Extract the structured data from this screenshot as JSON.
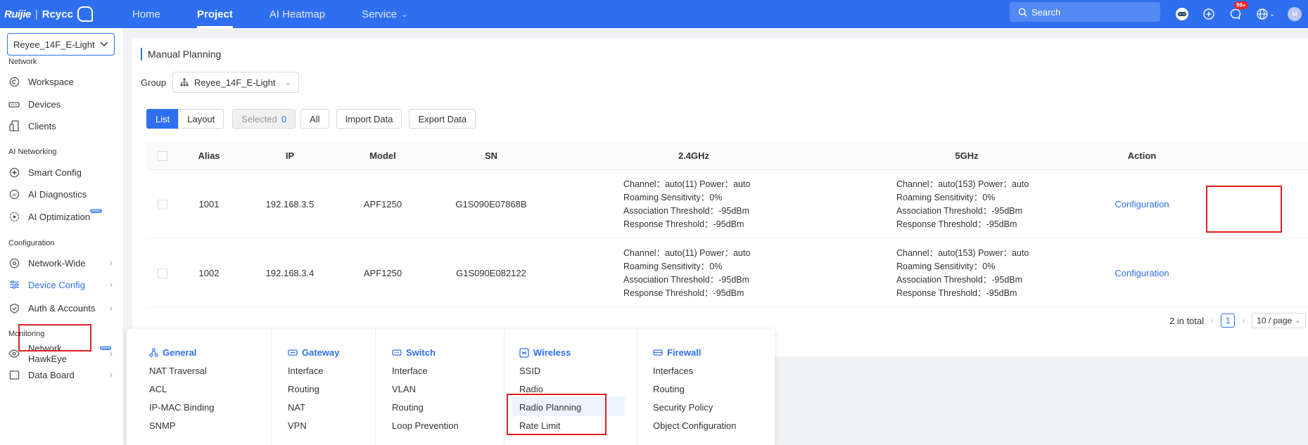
{
  "header": {
    "brand": "Ruijie",
    "brand_sub": "Rcycc",
    "nav": [
      {
        "label": "Home"
      },
      {
        "label": "Project"
      },
      {
        "label": "AI Heatmap"
      },
      {
        "label": "Service"
      }
    ],
    "search_placeholder": "Search",
    "notification_badge": "99+",
    "avatar_text": "M"
  },
  "sidebar": {
    "group_value": "Reyee_14F_E-Light",
    "sections": {
      "network": "Network",
      "ai": "AI Networking",
      "config": "Configuration",
      "monitoring": "Monitoring"
    },
    "items": {
      "workspace": "Workspace",
      "devices": "Devices",
      "clients": "Clients",
      "smart_config": "Smart Config",
      "ai_diagnostics": "AI Diagnostics",
      "ai_optimization": "AI Optimization",
      "network_wide": "Network-Wide",
      "device_config": "Device Config",
      "auth_accounts": "Auth & Accounts",
      "hawkeye": "Network HawkEye",
      "data_board": "Data Board"
    },
    "beta_label": "Beta"
  },
  "main": {
    "title": "Manual Planning",
    "group_label": "Group",
    "group_value": "Reyee_14F_E-Light",
    "toolbar": {
      "list": "List",
      "layout": "Layout",
      "selected": "Selected",
      "selected_count": "0",
      "all": "All",
      "import": "Import Data",
      "export": "Export Data"
    },
    "columns": [
      "Alias",
      "IP",
      "Model",
      "SN",
      "2.4GHz",
      "5GHz",
      "Action"
    ],
    "rows": [
      {
        "alias": "1001",
        "ip": "192.168.3.5",
        "model": "APF1250",
        "sn": "G1S090E07868B",
        "g24": [
          "Channel：auto(11)  Power：auto",
          "Roaming Sensitivity：0%",
          "Association Threshold：-95dBm",
          "Response Threshold：-95dBm"
        ],
        "g5": [
          "Channel：auto(153)  Power：auto",
          "Roaming Sensitivity：0%",
          "Association Threshold：-95dBm",
          "Response Threshold：-95dBm"
        ],
        "action": "Configuration"
      },
      {
        "alias": "1002",
        "ip": "192.168.3.4",
        "model": "APF1250",
        "sn": "G1S090E082122",
        "g24": [
          "Channel：auto(11)  Power：auto",
          "Roaming Sensitivity：0%",
          "Association Threshold：-95dBm",
          "Response Threshold：-95dBm"
        ],
        "g5": [
          "Channel：auto(153)  Power：auto",
          "Roaming Sensitivity：0%",
          "Association Threshold：-95dBm",
          "Response Threshold：-95dBm"
        ],
        "action": "Configuration"
      }
    ],
    "pager": {
      "total": "2 in total",
      "page": "1",
      "size": "10 / page"
    }
  },
  "menu": {
    "general": {
      "title": "General",
      "items": [
        "NAT Traversal",
        "ACL",
        "IP-MAC Binding",
        "SNMP"
      ]
    },
    "gateway": {
      "title": "Gateway",
      "items": [
        "Interface",
        "Routing",
        "NAT",
        "VPN"
      ]
    },
    "switch": {
      "title": "Switch",
      "items": [
        "Interface",
        "VLAN",
        "Routing",
        "Loop Prevention"
      ]
    },
    "wireless": {
      "title": "Wireless",
      "items": [
        "SSID",
        "Radio",
        "Radio Planning",
        "Rate Limit"
      ]
    },
    "firewall": {
      "title": "Firewall",
      "items": [
        "Interfaces",
        "Routing",
        "Security Policy",
        "Object Configuration"
      ]
    }
  }
}
